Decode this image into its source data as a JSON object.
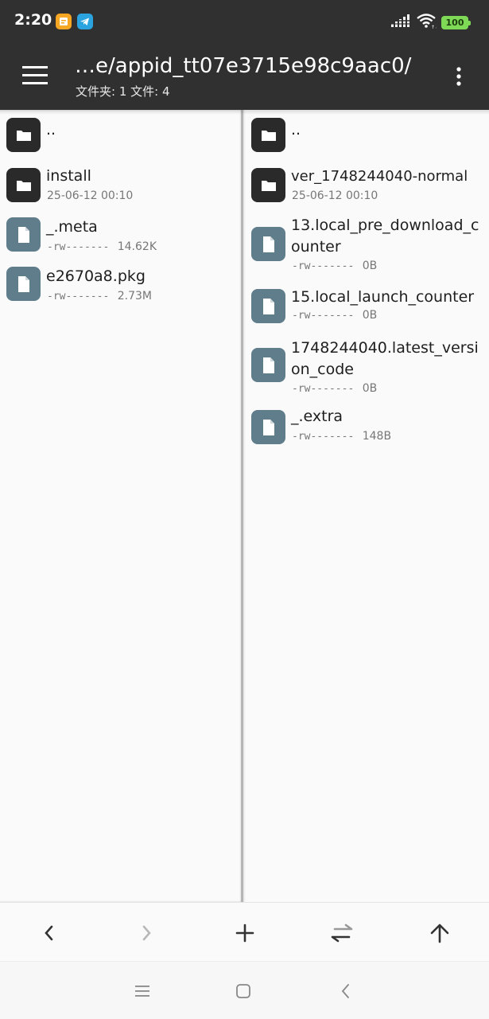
{
  "status_bar": {
    "time": "2:20",
    "battery": "100",
    "notification_icons": [
      "files-app-icon",
      "telegram-icon"
    ],
    "colors": {
      "background": "#303030",
      "battery": "#7ed957",
      "files_app": "#f5a623",
      "telegram": "#2aa3df"
    }
  },
  "app_bar": {
    "title": "…e/appid_tt07e3715e98c9aac0/",
    "subtitle": "文件夹: 1   文件: 4",
    "menu_icon": "hamburger-menu-icon",
    "overflow_icon": "more-vertical-icon"
  },
  "left_pane": {
    "items": [
      {
        "type": "folder",
        "name": "..",
        "date": "",
        "perm": "",
        "size": ""
      },
      {
        "type": "folder",
        "name": "install",
        "date": "25-06-12 00:10",
        "perm": "",
        "size": ""
      },
      {
        "type": "file",
        "name": "_.meta",
        "date": "",
        "perm": "-rw-------",
        "size": "14.62K"
      },
      {
        "type": "file",
        "name": "e2670a8.pkg",
        "date": "",
        "perm": "-rw-------",
        "size": "2.73M"
      }
    ]
  },
  "right_pane": {
    "items": [
      {
        "type": "folder",
        "name": "..",
        "date": "",
        "perm": "",
        "size": ""
      },
      {
        "type": "folder",
        "name": "ver_1748244040-normal",
        "date": "25-06-12 00:10",
        "perm": "",
        "size": ""
      },
      {
        "type": "file",
        "name": "13.local_pre_download_counter",
        "date": "",
        "perm": "-rw-------",
        "size": "0B"
      },
      {
        "type": "file",
        "name": "15.local_launch_counter",
        "date": "",
        "perm": "-rw-------",
        "size": "0B"
      },
      {
        "type": "file",
        "name": "1748244040.latest_version_code",
        "date": "",
        "perm": "-rw-------",
        "size": "0B"
      },
      {
        "type": "file",
        "name": "_.extra",
        "date": "",
        "perm": "-rw-------",
        "size": "148B"
      }
    ]
  },
  "bottom_toolbar": {
    "buttons": [
      "back-arrow-icon",
      "forward-arrow-icon",
      "add-icon",
      "swap-panes-icon",
      "parent-folder-up-icon"
    ]
  },
  "nav_bar": {
    "buttons": [
      "recents-menu-icon",
      "home-square-icon",
      "nav-back-icon"
    ]
  }
}
